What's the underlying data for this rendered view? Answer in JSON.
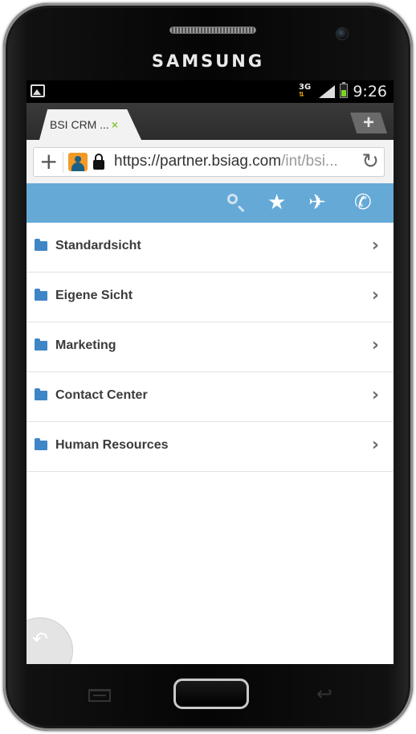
{
  "device": {
    "brand": "SAMSUNG"
  },
  "status_bar": {
    "network": "3G",
    "time": "9:26"
  },
  "browser": {
    "tab_title": "BSI CRM ...",
    "tab_close": "×",
    "new_tab": "+",
    "url_main": "https://partner.bsiag.com",
    "url_rest": "/int/bsi...",
    "add_symbol": "+",
    "reload_symbol": "↻"
  },
  "app_toolbar": {
    "icons": [
      "search-icon",
      "star-icon",
      "airplane-icon",
      "phone-icon"
    ],
    "star": "★",
    "airplane": "✈",
    "phone": "✆"
  },
  "menu": {
    "items": [
      {
        "label": "Standardsicht",
        "chevron": "›"
      },
      {
        "label": "Eigene Sicht",
        "chevron": "›"
      },
      {
        "label": "Marketing",
        "chevron": "›"
      },
      {
        "label": "Contact Center",
        "chevron": "›"
      },
      {
        "label": "Human Resources",
        "chevron": "›"
      }
    ]
  },
  "back_corner": {
    "symbol": "↶"
  },
  "hardware": {
    "back_key": "↩"
  },
  "colors": {
    "app_bar": "#65a9d6",
    "folder": "#3f86c6",
    "tab_close": "#8cc63f"
  }
}
